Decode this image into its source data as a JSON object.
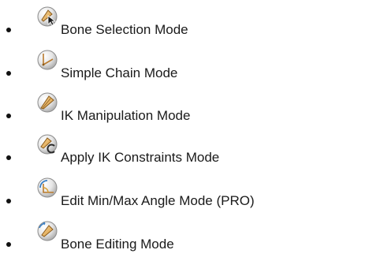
{
  "modes": [
    {
      "icon": "bone-selection-icon",
      "label": "Bone Selection Mode"
    },
    {
      "icon": "simple-chain-icon",
      "label": "Simple Chain Mode"
    },
    {
      "icon": "ik-manipulation-icon",
      "label": "IK Manipulation Mode"
    },
    {
      "icon": "ik-constraints-icon",
      "label": "Apply IK Constraints Mode"
    },
    {
      "icon": "angle-limits-icon",
      "label": "Edit Min/Max Angle Mode (PRO)"
    },
    {
      "icon": "bone-editing-icon",
      "label": "Bone Editing Mode"
    }
  ]
}
